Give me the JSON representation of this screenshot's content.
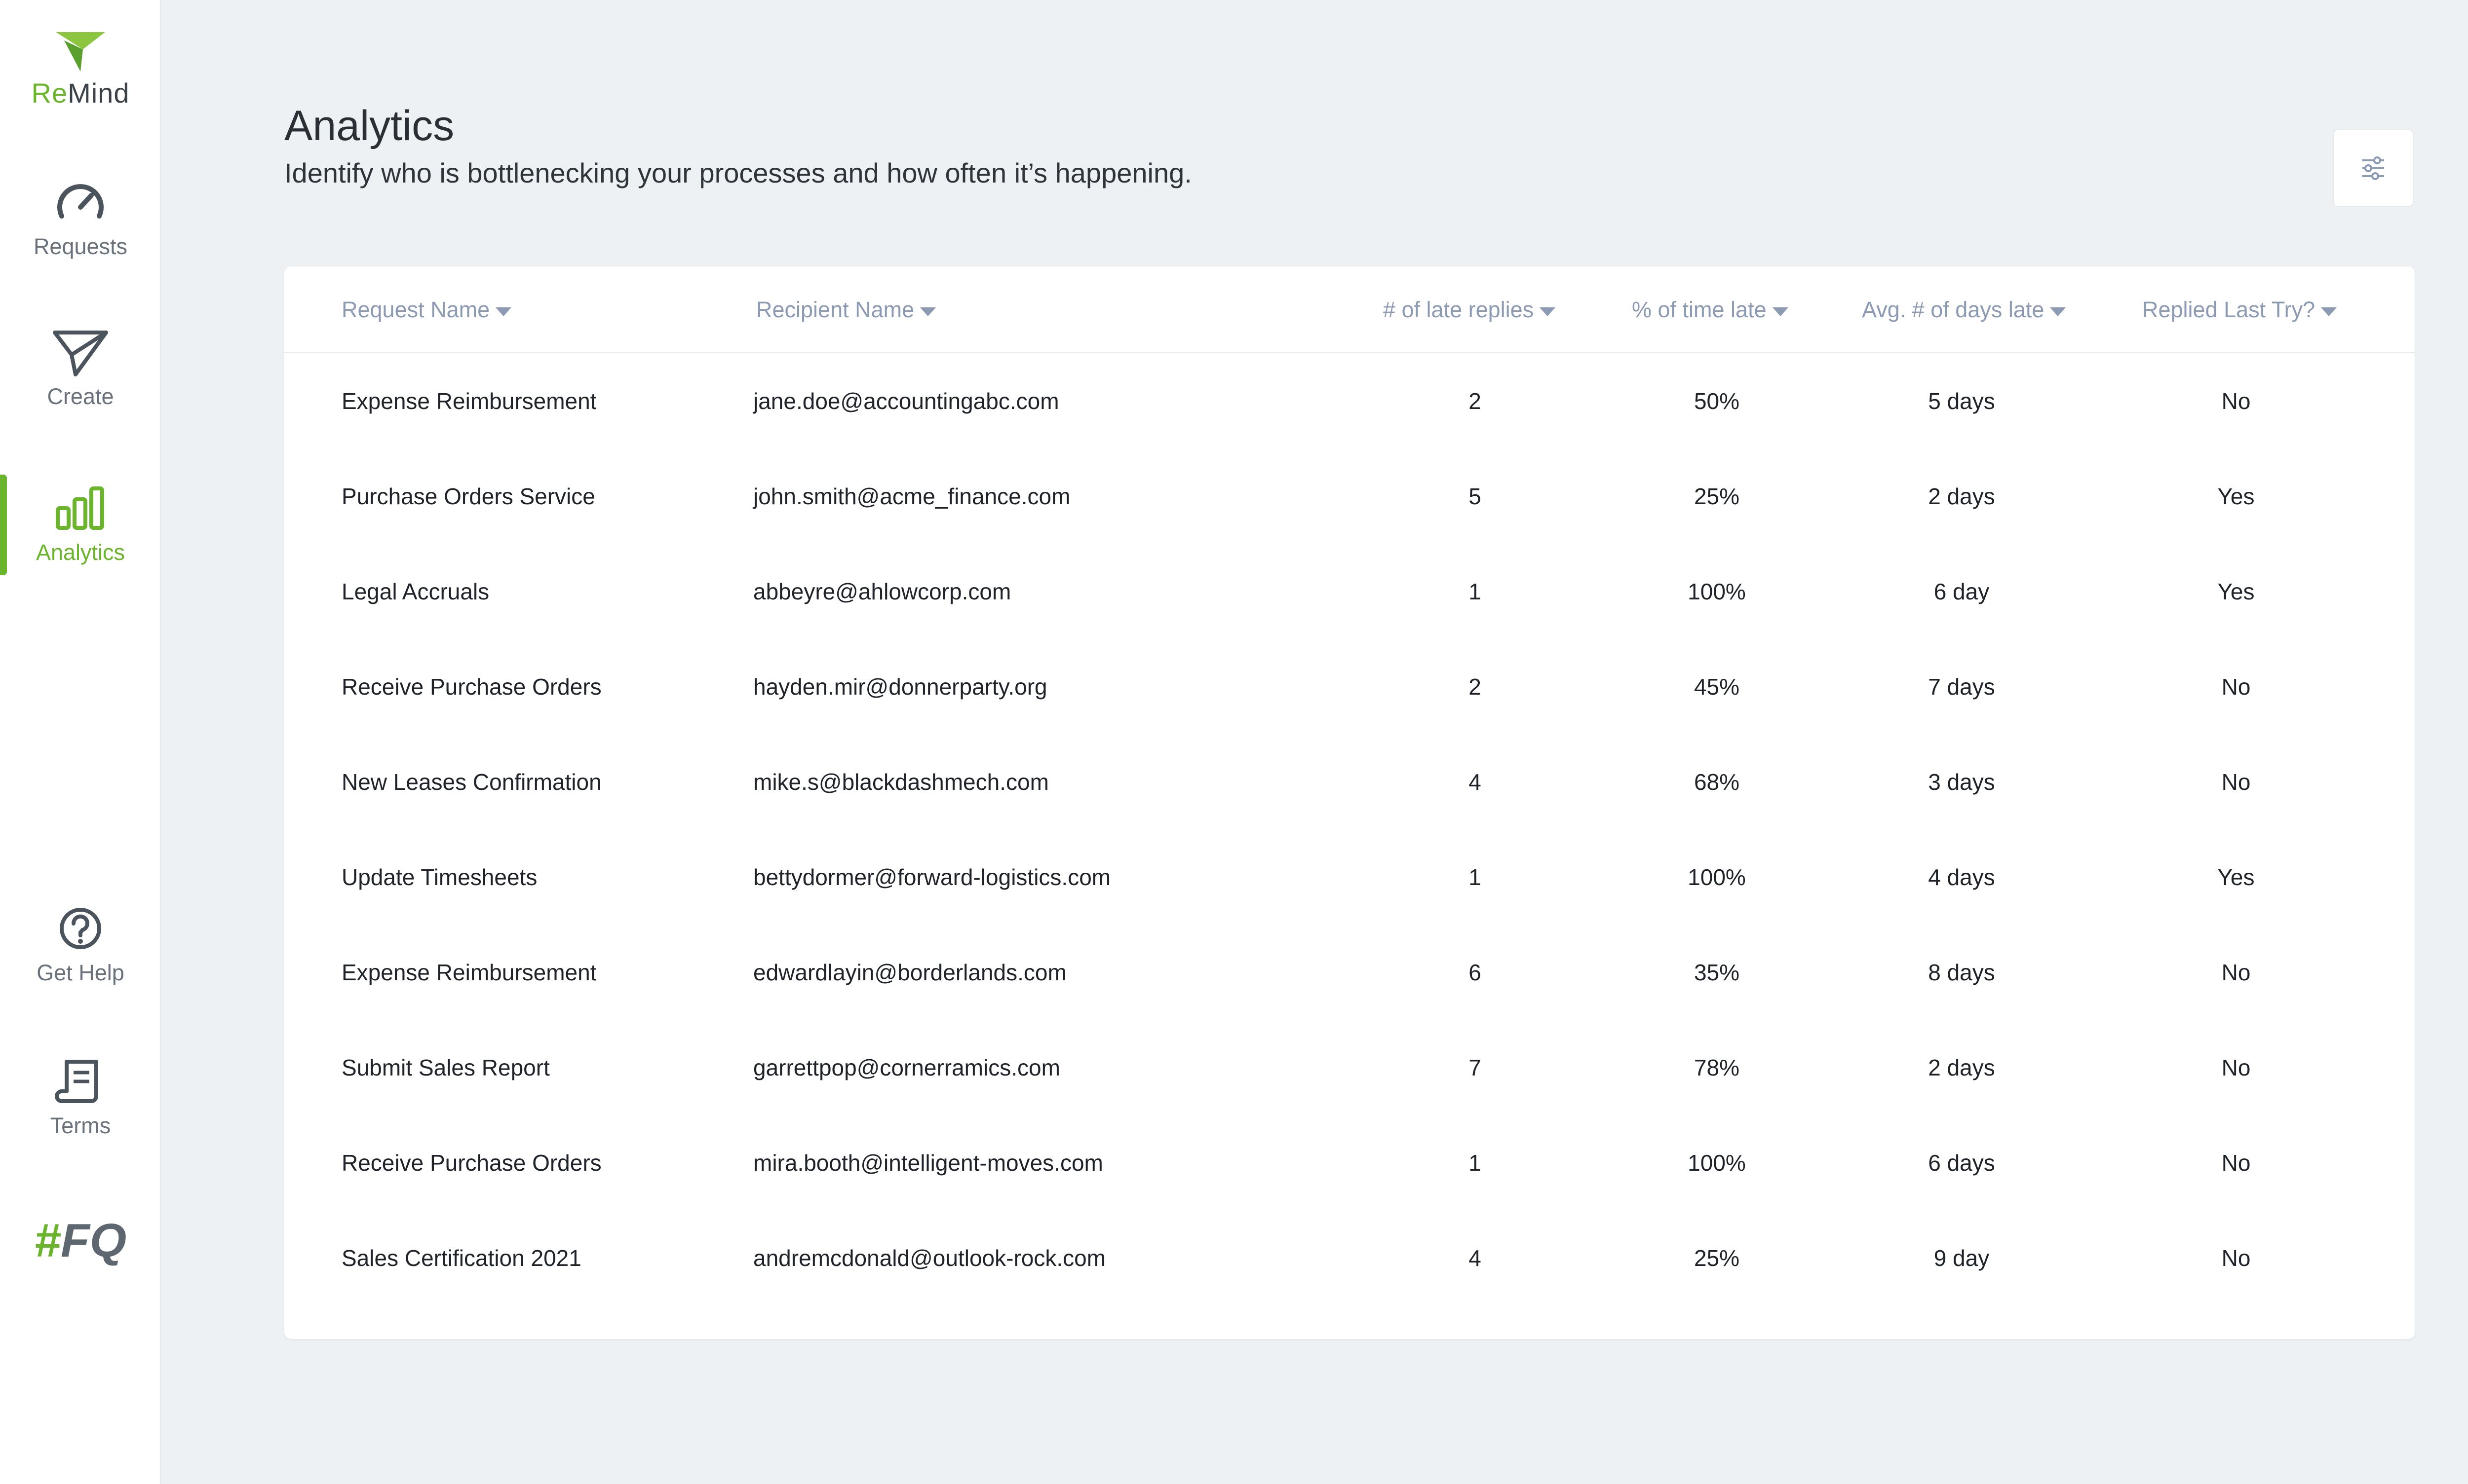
{
  "app": {
    "logo": {
      "prefix": "Re",
      "suffix": "Mind"
    },
    "footer_logo": {
      "hash": "#",
      "text": "FQ"
    }
  },
  "sidebar": {
    "items": [
      {
        "label": "Requests",
        "icon": "speedometer-icon"
      },
      {
        "label": "Create",
        "icon": "paper-plane-icon"
      },
      {
        "label": "Analytics",
        "icon": "bar-chart-icon",
        "active": true
      },
      {
        "label": "Get Help",
        "icon": "help-circle-icon"
      },
      {
        "label": "Terms",
        "icon": "document-scroll-icon"
      }
    ]
  },
  "header": {
    "title": "Analytics",
    "subtitle": "Identify who is bottlenecking your processes and how often it’s happening.",
    "filter_icon": "sliders-icon"
  },
  "table": {
    "columns": [
      "Request Name",
      "Recipient Name",
      "# of late replies",
      "% of time late",
      "Avg. # of days late",
      "Replied Last Try?"
    ],
    "rows": [
      [
        "Expense Reimbursement",
        "jane.doe@accountingabc.com",
        "2",
        "50%",
        "5 days",
        "No"
      ],
      [
        "Purchase Orders Service",
        "john.smith@acme_finance.com",
        "5",
        "25%",
        "2 days",
        "Yes"
      ],
      [
        "Legal Accruals",
        "abbeyre@ahlowcorp.com",
        "1",
        "100%",
        "6 day",
        "Yes"
      ],
      [
        "Receive Purchase Orders",
        "hayden.mir@donnerparty.org",
        "2",
        "45%",
        "7 days",
        "No"
      ],
      [
        "New Leases Confirmation",
        "mike.s@blackdashmech.com",
        "4",
        "68%",
        "3 days",
        "No"
      ],
      [
        "Update Timesheets",
        "bettydormer@forward-logistics.com",
        "1",
        "100%",
        "4 days",
        "Yes"
      ],
      [
        "Expense Reimbursement",
        "edwardlayin@borderlands.com",
        "6",
        "35%",
        "8 days",
        "No"
      ],
      [
        "Submit Sales Report",
        "garrettpop@cornerramics.com",
        "7",
        "78%",
        "2 days",
        "No"
      ],
      [
        "Receive Purchase Orders",
        "mira.booth@intelligent-moves.com",
        "1",
        "100%",
        "6 days",
        "No"
      ],
      [
        "Sales Certification 2021",
        "andremcdonald@outlook-rock.com",
        "4",
        "25%",
        "9 day",
        "No"
      ]
    ]
  },
  "colors": {
    "accent": "#6bb52d",
    "header_text": "#8c9bb3",
    "background": "#eef1f4"
  }
}
